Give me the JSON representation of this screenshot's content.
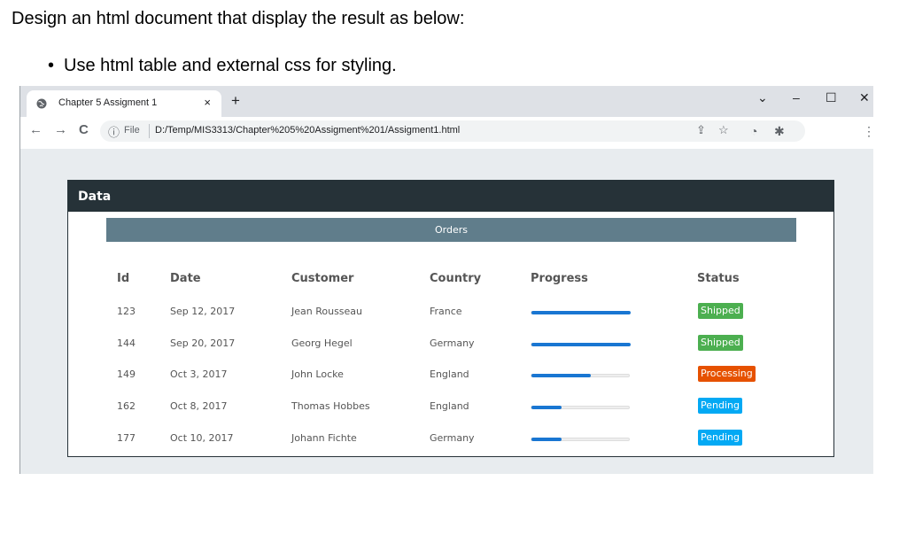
{
  "instructions": {
    "title": "Design an html document that display the result as below:",
    "bullet": "•",
    "bullet_text": "Use html  table and external css for styling."
  },
  "browser": {
    "tab_title": "Chapter 5 Assigment 1",
    "tab_close": "×",
    "new_tab": "+",
    "window_controls": {
      "chevron": "⌄",
      "minimize": "–",
      "maximize": "☐",
      "close": "✕"
    },
    "nav": {
      "back": "←",
      "forward": "→",
      "reload": "C"
    },
    "address": {
      "info": "ⓘ",
      "scheme_label": "File",
      "url": "D:/Temp/MIS3313/Chapter%205%20Assigment%201/Assigment1.html",
      "share": "⇪",
      "star": "☆"
    },
    "extensions": {
      "profile": "◔",
      "puzzle": "✱",
      "menu": "⋮"
    }
  },
  "page": {
    "card_title": "Data",
    "table_caption": "Orders",
    "headers": [
      "Id",
      "Date",
      "Customer",
      "Country",
      "Progress",
      "Status"
    ],
    "rows": [
      {
        "id": "123",
        "date": "Sep 12, 2017",
        "customer": "Jean Rousseau",
        "country": "France",
        "progress": 1.0,
        "status": "Shipped",
        "status_color": "#4caf50"
      },
      {
        "id": "144",
        "date": "Sep 20, 2017",
        "customer": "Georg Hegel",
        "country": "Germany",
        "progress": 1.0,
        "status": "Shipped",
        "status_color": "#4caf50"
      },
      {
        "id": "149",
        "date": "Oct 3, 2017",
        "customer": "John Locke",
        "country": "England",
        "progress": 0.6,
        "status": "Processing",
        "status_color": "#e65100"
      },
      {
        "id": "162",
        "date": "Oct 8, 2017",
        "customer": "Thomas Hobbes",
        "country": "England",
        "progress": 0.3,
        "status": "Pending",
        "status_color": "#03a9f4"
      },
      {
        "id": "177",
        "date": "Oct 10, 2017",
        "customer": "Johann Fichte",
        "country": "Germany",
        "progress": 0.3,
        "status": "Pending",
        "status_color": "#03a9f4"
      }
    ]
  },
  "colors": {
    "header_dark": "#263238",
    "caption_bar": "#607d8b",
    "progress_fill": "#1976d2"
  }
}
